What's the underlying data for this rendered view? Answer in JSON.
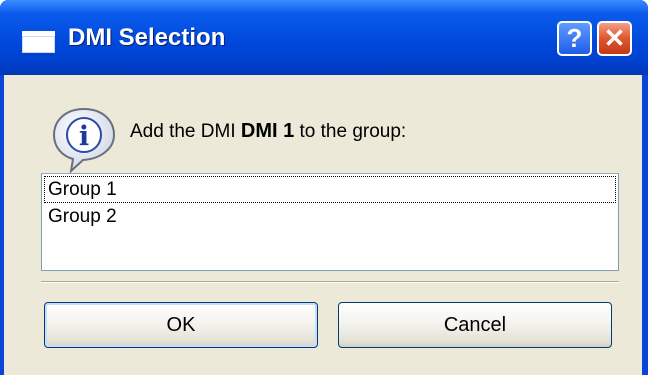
{
  "window": {
    "title": "DMI Selection",
    "help_label": "?",
    "close_label": "✕"
  },
  "message": {
    "prefix": "Add the DMI ",
    "dmi_name": "DMI 1",
    "suffix": " to the group:"
  },
  "groups": {
    "items": [
      {
        "label": "Group 1",
        "focused": true
      },
      {
        "label": "Group 2",
        "focused": false
      }
    ]
  },
  "buttons": {
    "ok_label": "OK",
    "cancel_label": "Cancel"
  },
  "colors": {
    "titlebar": "#0a5bec",
    "dialog_bg": "#ece9d8",
    "close_btn": "#e0562e",
    "help_btn": "#3a7ef5"
  },
  "icons": [
    "window-icon",
    "help-icon",
    "close-icon",
    "info-icon"
  ]
}
